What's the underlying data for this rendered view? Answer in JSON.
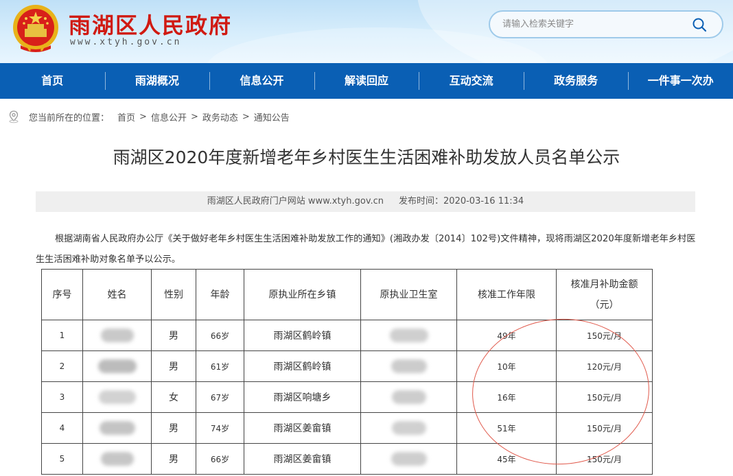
{
  "site": {
    "title": "雨湖区人民政府",
    "domain": "www.xtyh.gov.cn"
  },
  "search": {
    "placeholder": "请输入检索关键字"
  },
  "nav": [
    "首页",
    "雨湖概况",
    "信息公开",
    "解读回应",
    "互动交流",
    "政务服务",
    "一件事一次办"
  ],
  "breadcrumb": {
    "prefix": "您当前所在的位置：",
    "items": [
      "首页",
      "信息公开",
      "政务动态",
      "通知公告"
    ]
  },
  "article": {
    "title": "雨湖区2020年度新增老年乡村医生生活困难补助发放人员名单公示",
    "source": "雨湖区人民政府门户网站 www.xtyh.gov.cn",
    "publish_time": "发布时间：2020-03-16 11:34",
    "paragraph": "根据湖南省人民政府办公厅《关于做好老年乡村医生生活困难补助发放工作的通知》(湘政办发〔2014〕102号)文件精神，现将雨湖区2020年度新增老年乡村医生生活困难补助对象名单予以公示。"
  },
  "table": {
    "headers": [
      "序号",
      "姓名",
      "性别",
      "年龄",
      "原执业所在乡镇",
      "原执业卫生室",
      "核准工作年限",
      "核准月补助金额",
      "（元）"
    ],
    "rows": [
      {
        "no": "1",
        "gender": "男",
        "age": "66岁",
        "town": "雨湖区鹤岭镇",
        "years": "49年",
        "amount": "150元/月"
      },
      {
        "no": "2",
        "gender": "男",
        "age": "61岁",
        "town": "雨湖区鹤岭镇",
        "years": "10年",
        "amount": "120元/月"
      },
      {
        "no": "3",
        "gender": "女",
        "age": "67岁",
        "town": "雨湖区响塘乡",
        "years": "16年",
        "amount": "150元/月"
      },
      {
        "no": "4",
        "gender": "男",
        "age": "74岁",
        "town": "雨湖区姜畲镇",
        "years": "51年",
        "amount": "150元/月"
      },
      {
        "no": "5",
        "gender": "男",
        "age": "66岁",
        "town": "雨湖区姜畲镇",
        "years": "45年",
        "amount": "150元/月"
      }
    ]
  },
  "colors": {
    "nav": "#0a5fb4",
    "site_title": "#d01a12",
    "annotation_circle": "#e0584a"
  }
}
